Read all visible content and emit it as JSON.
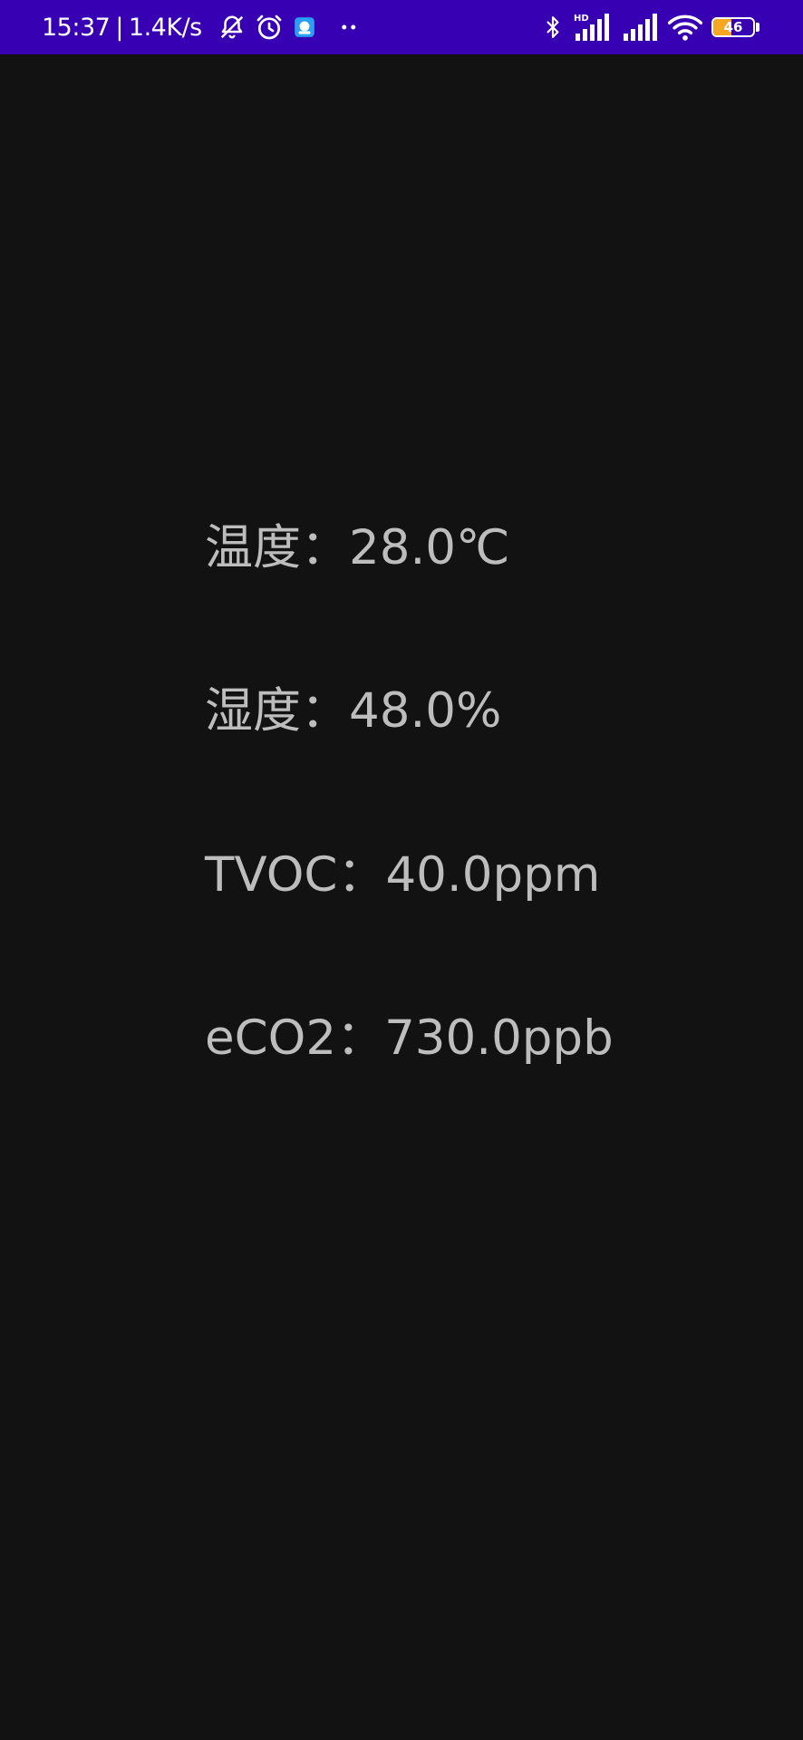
{
  "status_bar": {
    "time": "15:37",
    "separator": "|",
    "net_speed": "1.4K/s",
    "battery_level": "46",
    "battery_fraction": 0.46,
    "background_color": "#3700b3",
    "icons_left": [
      "bell-off-icon",
      "alarm-icon",
      "app-notification-icon",
      "more-dots-icon"
    ],
    "icons_right": [
      "bluetooth-icon",
      "hd-signal-icon",
      "signal-icon",
      "wifi-icon",
      "battery-icon"
    ]
  },
  "readings": [
    {
      "label": "温度",
      "colon": "：",
      "value": "28.0℃"
    },
    {
      "label": "湿度",
      "colon": "：",
      "value": "48.0%"
    },
    {
      "label": "TVOC",
      "colon": "：",
      "value": "40.0ppm"
    },
    {
      "label": "eCO2",
      "colon": "：",
      "value": "730.0ppb"
    }
  ],
  "colors": {
    "background": "#121212",
    "text": "#bdbdbd",
    "status_bar": "#3700b3",
    "battery_fill": "#f5a623"
  }
}
